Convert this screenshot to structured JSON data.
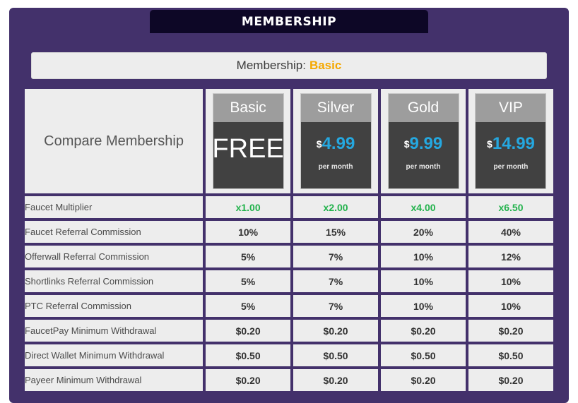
{
  "header": {
    "title": "MEMBERSHIP"
  },
  "status": {
    "label": "Membership:",
    "value": "Basic"
  },
  "table": {
    "compare_label": "Compare Membership",
    "plans": [
      {
        "name": "Basic",
        "currency": "",
        "price": "FREE",
        "period": "",
        "free": true
      },
      {
        "name": "Silver",
        "currency": "$",
        "price": "4.99",
        "period": "per month",
        "free": false
      },
      {
        "name": "Gold",
        "currency": "$",
        "price": "9.99",
        "period": "per month",
        "free": false
      },
      {
        "name": "VIP",
        "currency": "$",
        "price": "14.99",
        "period": "per month",
        "free": false
      }
    ],
    "rows": [
      {
        "label": "Faucet Multiplier",
        "values": [
          "x1.00",
          "x2.00",
          "x4.00",
          "x6.50"
        ],
        "accent": true
      },
      {
        "label": "Faucet Referral Commission",
        "values": [
          "10%",
          "15%",
          "20%",
          "40%"
        ],
        "accent": false
      },
      {
        "label": "Offerwall Referral Commission",
        "values": [
          "5%",
          "7%",
          "10%",
          "12%"
        ],
        "accent": false
      },
      {
        "label": "Shortlinks Referral Commission",
        "values": [
          "5%",
          "7%",
          "10%",
          "10%"
        ],
        "accent": false
      },
      {
        "label": "PTC Referral Commission",
        "values": [
          "5%",
          "7%",
          "10%",
          "10%"
        ],
        "accent": false
      },
      {
        "label": "FaucetPay Minimum Withdrawal",
        "values": [
          "$0.20",
          "$0.20",
          "$0.20",
          "$0.20"
        ],
        "accent": false
      },
      {
        "label": "Direct Wallet Minimum Withdrawal",
        "values": [
          "$0.50",
          "$0.50",
          "$0.50",
          "$0.50"
        ],
        "accent": false
      },
      {
        "label": "Payeer Minimum Withdrawal",
        "values": [
          "$0.20",
          "$0.20",
          "$0.20",
          "$0.20"
        ],
        "accent": false
      }
    ]
  },
  "colors": {
    "panel": "#43316b",
    "title_bar": "#0d0726",
    "accent_green": "#22b24c",
    "price_blue": "#25a8e0",
    "membership_gold": "#f5a800",
    "card_header_gray": "#9d9d9d",
    "card_body_dark": "#414141",
    "cell_bg": "#ededed"
  }
}
